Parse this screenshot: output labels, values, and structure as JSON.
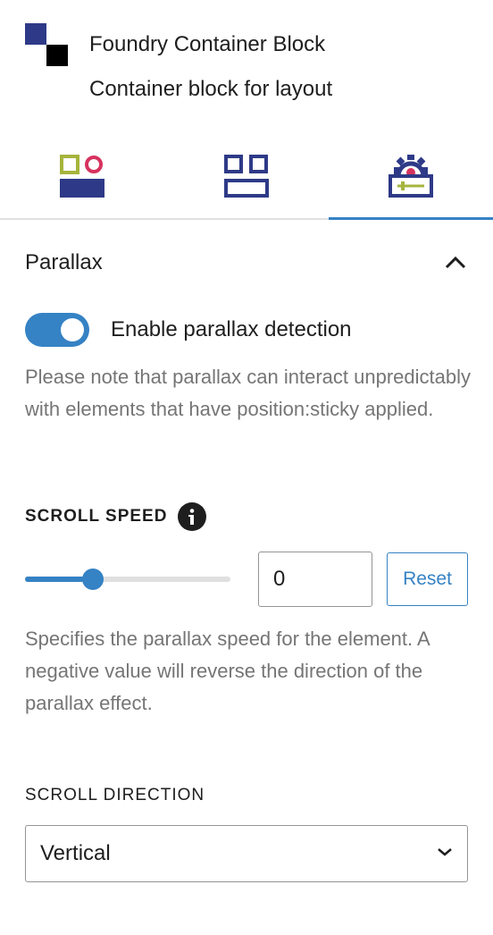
{
  "block": {
    "title": "Foundry Container Block",
    "description": "Container block for layout",
    "logo_colors": {
      "primary": "#2e3a87",
      "secondary": "#000000"
    }
  },
  "tabs": [
    {
      "name": "styles-tab",
      "icon": "styles-icon"
    },
    {
      "name": "layout-tab",
      "icon": "layout-grid-icon"
    },
    {
      "name": "advanced-settings-tab",
      "icon": "settings-gear-icon",
      "active": true
    }
  ],
  "parallax": {
    "panel_title": "Parallax",
    "expanded": true,
    "toggle": {
      "label": "Enable parallax detection",
      "enabled": true
    },
    "toggle_help": "Please note that parallax can interact unpredictably with elements that have position:sticky applied.",
    "scroll_speed": {
      "label": "SCROLL SPEED",
      "slider_fraction": 0.33,
      "value": "0",
      "reset_label": "Reset",
      "help": "Specifies the parallax speed for the element. A negative value will reverse the direction of the parallax effect."
    },
    "scroll_direction": {
      "label": "SCROLL DIRECTION",
      "selected": "Vertical"
    }
  },
  "colors": {
    "accent": "#3582c4",
    "icon_navy": "#2e3a87",
    "icon_green": "#a6b43d",
    "icon_pink": "#d6335f",
    "help_text": "#757575"
  }
}
